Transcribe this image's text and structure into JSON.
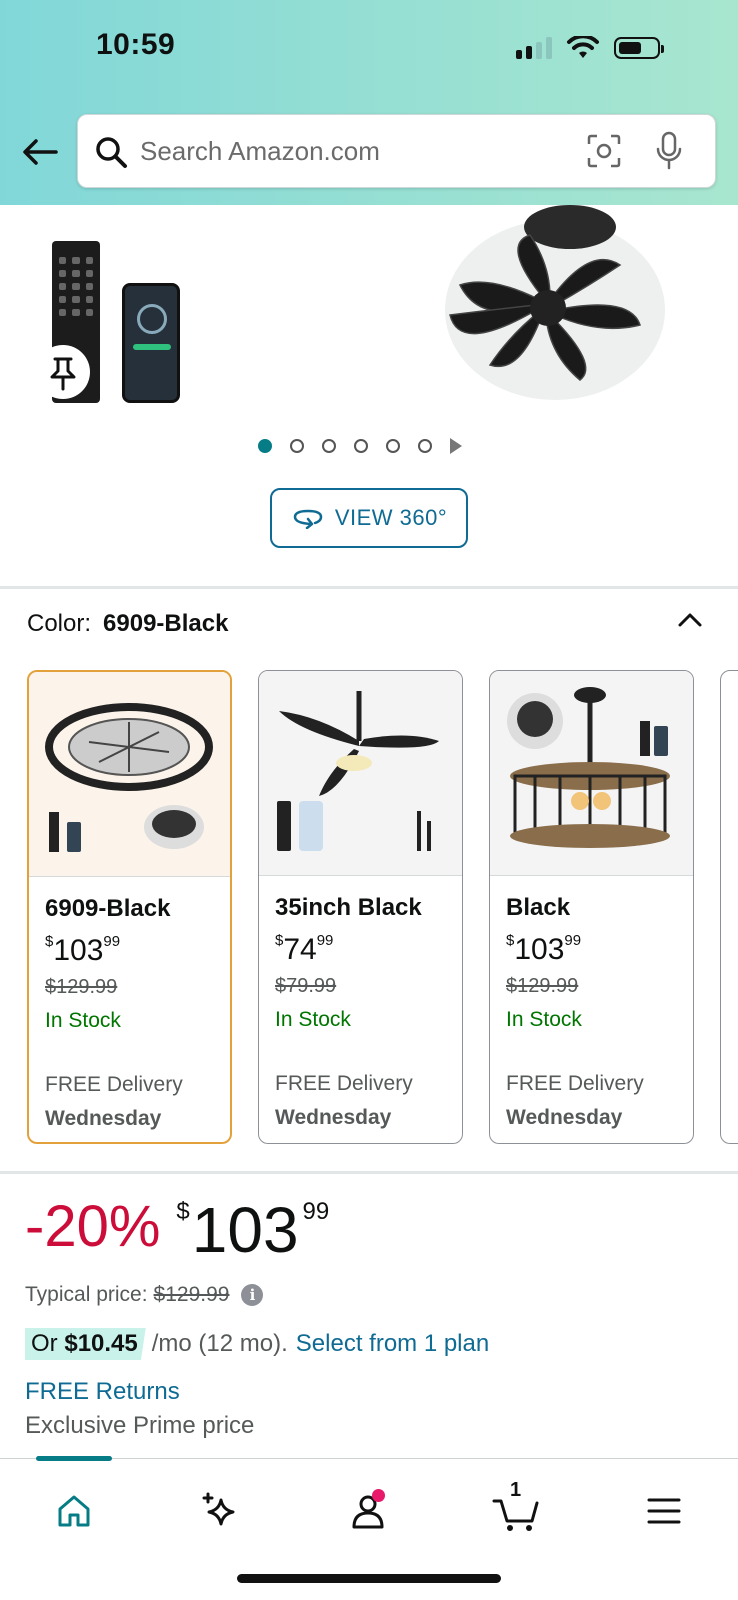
{
  "status_bar": {
    "time": "10:59"
  },
  "search": {
    "placeholder": "Search Amazon.com"
  },
  "gallery": {
    "view360_label": "VIEW 360°",
    "dot_count": 6,
    "active_dot": 0
  },
  "color_selector": {
    "label": "Color:",
    "selected": "6909-Black"
  },
  "variants": [
    {
      "name": "6909-Black",
      "price_dollars": "103",
      "price_cents": "99",
      "list_price": "$129.99",
      "stock": "In Stock",
      "delivery": "FREE Delivery",
      "delivery_day": "Wednesday",
      "selected": true
    },
    {
      "name": "35inch Black",
      "price_dollars": "74",
      "price_cents": "99",
      "list_price": "$79.99",
      "stock": "In Stock",
      "delivery": "FREE Delivery",
      "delivery_day": "Wednesday",
      "selected": false
    },
    {
      "name": "Black",
      "price_dollars": "103",
      "price_cents": "99",
      "list_price": "$129.99",
      "stock": "In Stock",
      "delivery": "FREE Delivery",
      "delivery_day": "Wednesday",
      "selected": false
    }
  ],
  "price_block": {
    "discount": "-20%",
    "currency": "$",
    "dollars": "103",
    "cents": "99",
    "typical_label": "Typical price:",
    "typical_price": "$129.99",
    "installment_or": "Or",
    "installment_amount": "$10.45",
    "installment_term": "/mo (12 mo).",
    "installment_link": "Select from 1 plan",
    "returns": "FREE Returns",
    "prime": "Exclusive Prime price"
  },
  "bottom_nav": {
    "items": [
      "home",
      "rufus",
      "account",
      "cart",
      "menu"
    ],
    "active": "home",
    "cart_count": "1"
  },
  "colors": {
    "accent_teal": "#067d86",
    "link_blue": "#0f6b93",
    "discount_red": "#cc0c39",
    "stock_green": "#007600",
    "selected_border": "#e3a13b"
  }
}
